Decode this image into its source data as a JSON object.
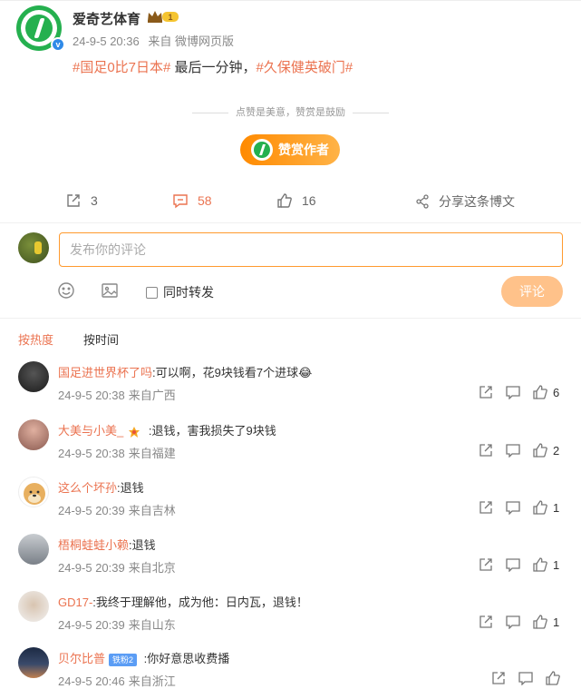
{
  "post": {
    "author": "爱奇艺体育",
    "crown_level": "1",
    "date": "24-9-5 20:36",
    "source": "来自 微博网页版",
    "tag1": "#国足0比7日本#",
    "text_mid": " 最后一分钟，",
    "tag2": "#久保健英破门#",
    "tip": "点赞是美意，赞赏是鼓励",
    "reward_label": "赞赏作者"
  },
  "actions": {
    "repost_count": "3",
    "comment_count": "58",
    "like_count": "16",
    "share_label": "分享这条博文"
  },
  "compose": {
    "placeholder": "发布你的评论",
    "repost_label": "同时转发",
    "submit_label": "评论"
  },
  "sort": {
    "hot": "按热度",
    "time": "按时间"
  },
  "comments": [
    {
      "name": "国足进世界杯了吗",
      "text": ":可以啊，花9块钱看7个进球",
      "emoji": "😂",
      "date": "24-9-5 20:38",
      "loc": "来自广西",
      "likes": "6"
    },
    {
      "name": "大美与小美_",
      "text": " :退钱，害我损失了9块钱",
      "date": "24-9-5 20:38",
      "loc": "来自福建",
      "likes": "2"
    },
    {
      "name": "这么个坏孙",
      "text": ":退钱",
      "date": "24-9-5 20:39",
      "loc": "来自吉林",
      "likes": "1"
    },
    {
      "name": "梧桐蛙蛙小赖",
      "text": ":退钱",
      "date": "24-9-5 20:39",
      "loc": "来自北京",
      "likes": "1"
    },
    {
      "name": "GD17-",
      "text": ":我终于理解他，成为他：日内瓦，退钱！",
      "date": "24-9-5 20:39",
      "loc": "来自山东",
      "likes": "1"
    },
    {
      "name": "贝尔比普",
      "level": "铁粉2",
      "text": " :你好意思收费播",
      "date": "24-9-5 20:46",
      "loc": "来自浙江",
      "likes": ""
    }
  ],
  "colors": {
    "accent": "#eb7350",
    "brand_green": "#25b04f",
    "submit_disabled": "#ffc28a",
    "input_border": "#ff9a2e"
  }
}
